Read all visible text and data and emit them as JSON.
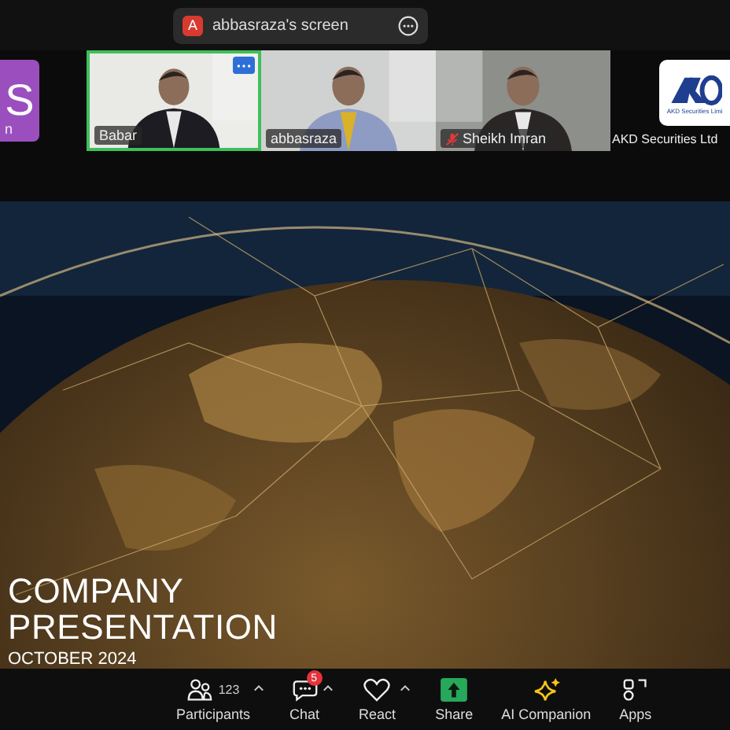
{
  "share_banner": {
    "avatar_letter": "A",
    "title": "abbasraza's screen"
  },
  "participants_strip": [
    {
      "kind": "avatar",
      "letter": "S",
      "name": "n",
      "active_speaker": false,
      "muted": false
    },
    {
      "kind": "video",
      "name": "Babar",
      "active_speaker": true,
      "muted": false
    },
    {
      "kind": "video",
      "name": "abbasraza",
      "active_speaker": false,
      "muted": false
    },
    {
      "kind": "video",
      "name": "Sheikh Imran",
      "active_speaker": false,
      "muted": true
    },
    {
      "kind": "logo",
      "caption": "AKD Securities Limi",
      "name": "AKD Securities Ltd",
      "active_speaker": false,
      "muted": false
    }
  ],
  "slide": {
    "title_lines": [
      "COMPANY",
      "PRESENTATION"
    ],
    "subtitle": "OCTOBER 2024"
  },
  "toolbar": [
    {
      "kind": "participants",
      "label": "Participants",
      "count": "123",
      "caret": true
    },
    {
      "kind": "chat",
      "label": "Chat",
      "badge": "5",
      "caret": true
    },
    {
      "kind": "react",
      "label": "React",
      "caret": true
    },
    {
      "kind": "share",
      "label": "Share"
    },
    {
      "kind": "ai",
      "label": "AI Companion"
    },
    {
      "kind": "apps",
      "label": "Apps"
    }
  ]
}
